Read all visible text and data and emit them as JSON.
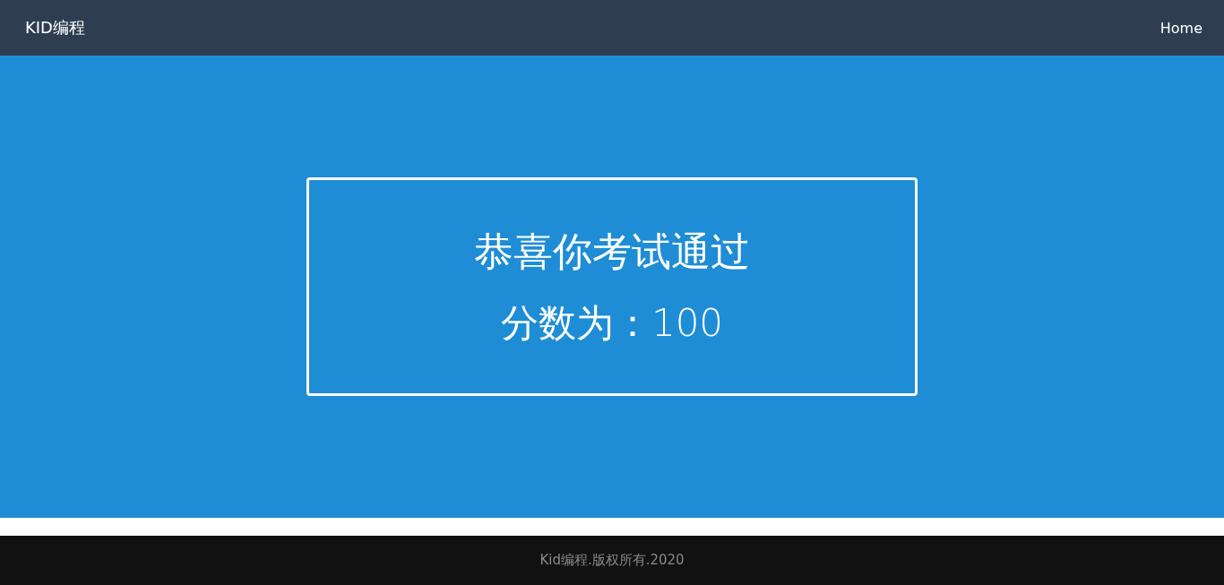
{
  "navbar": {
    "brand": "KID编程",
    "links": [
      {
        "label": "Home"
      }
    ]
  },
  "result": {
    "heading": "恭喜你考试通过",
    "score": "分数为：100"
  },
  "footer": {
    "text": "Kid编程.版权所有.2020"
  }
}
